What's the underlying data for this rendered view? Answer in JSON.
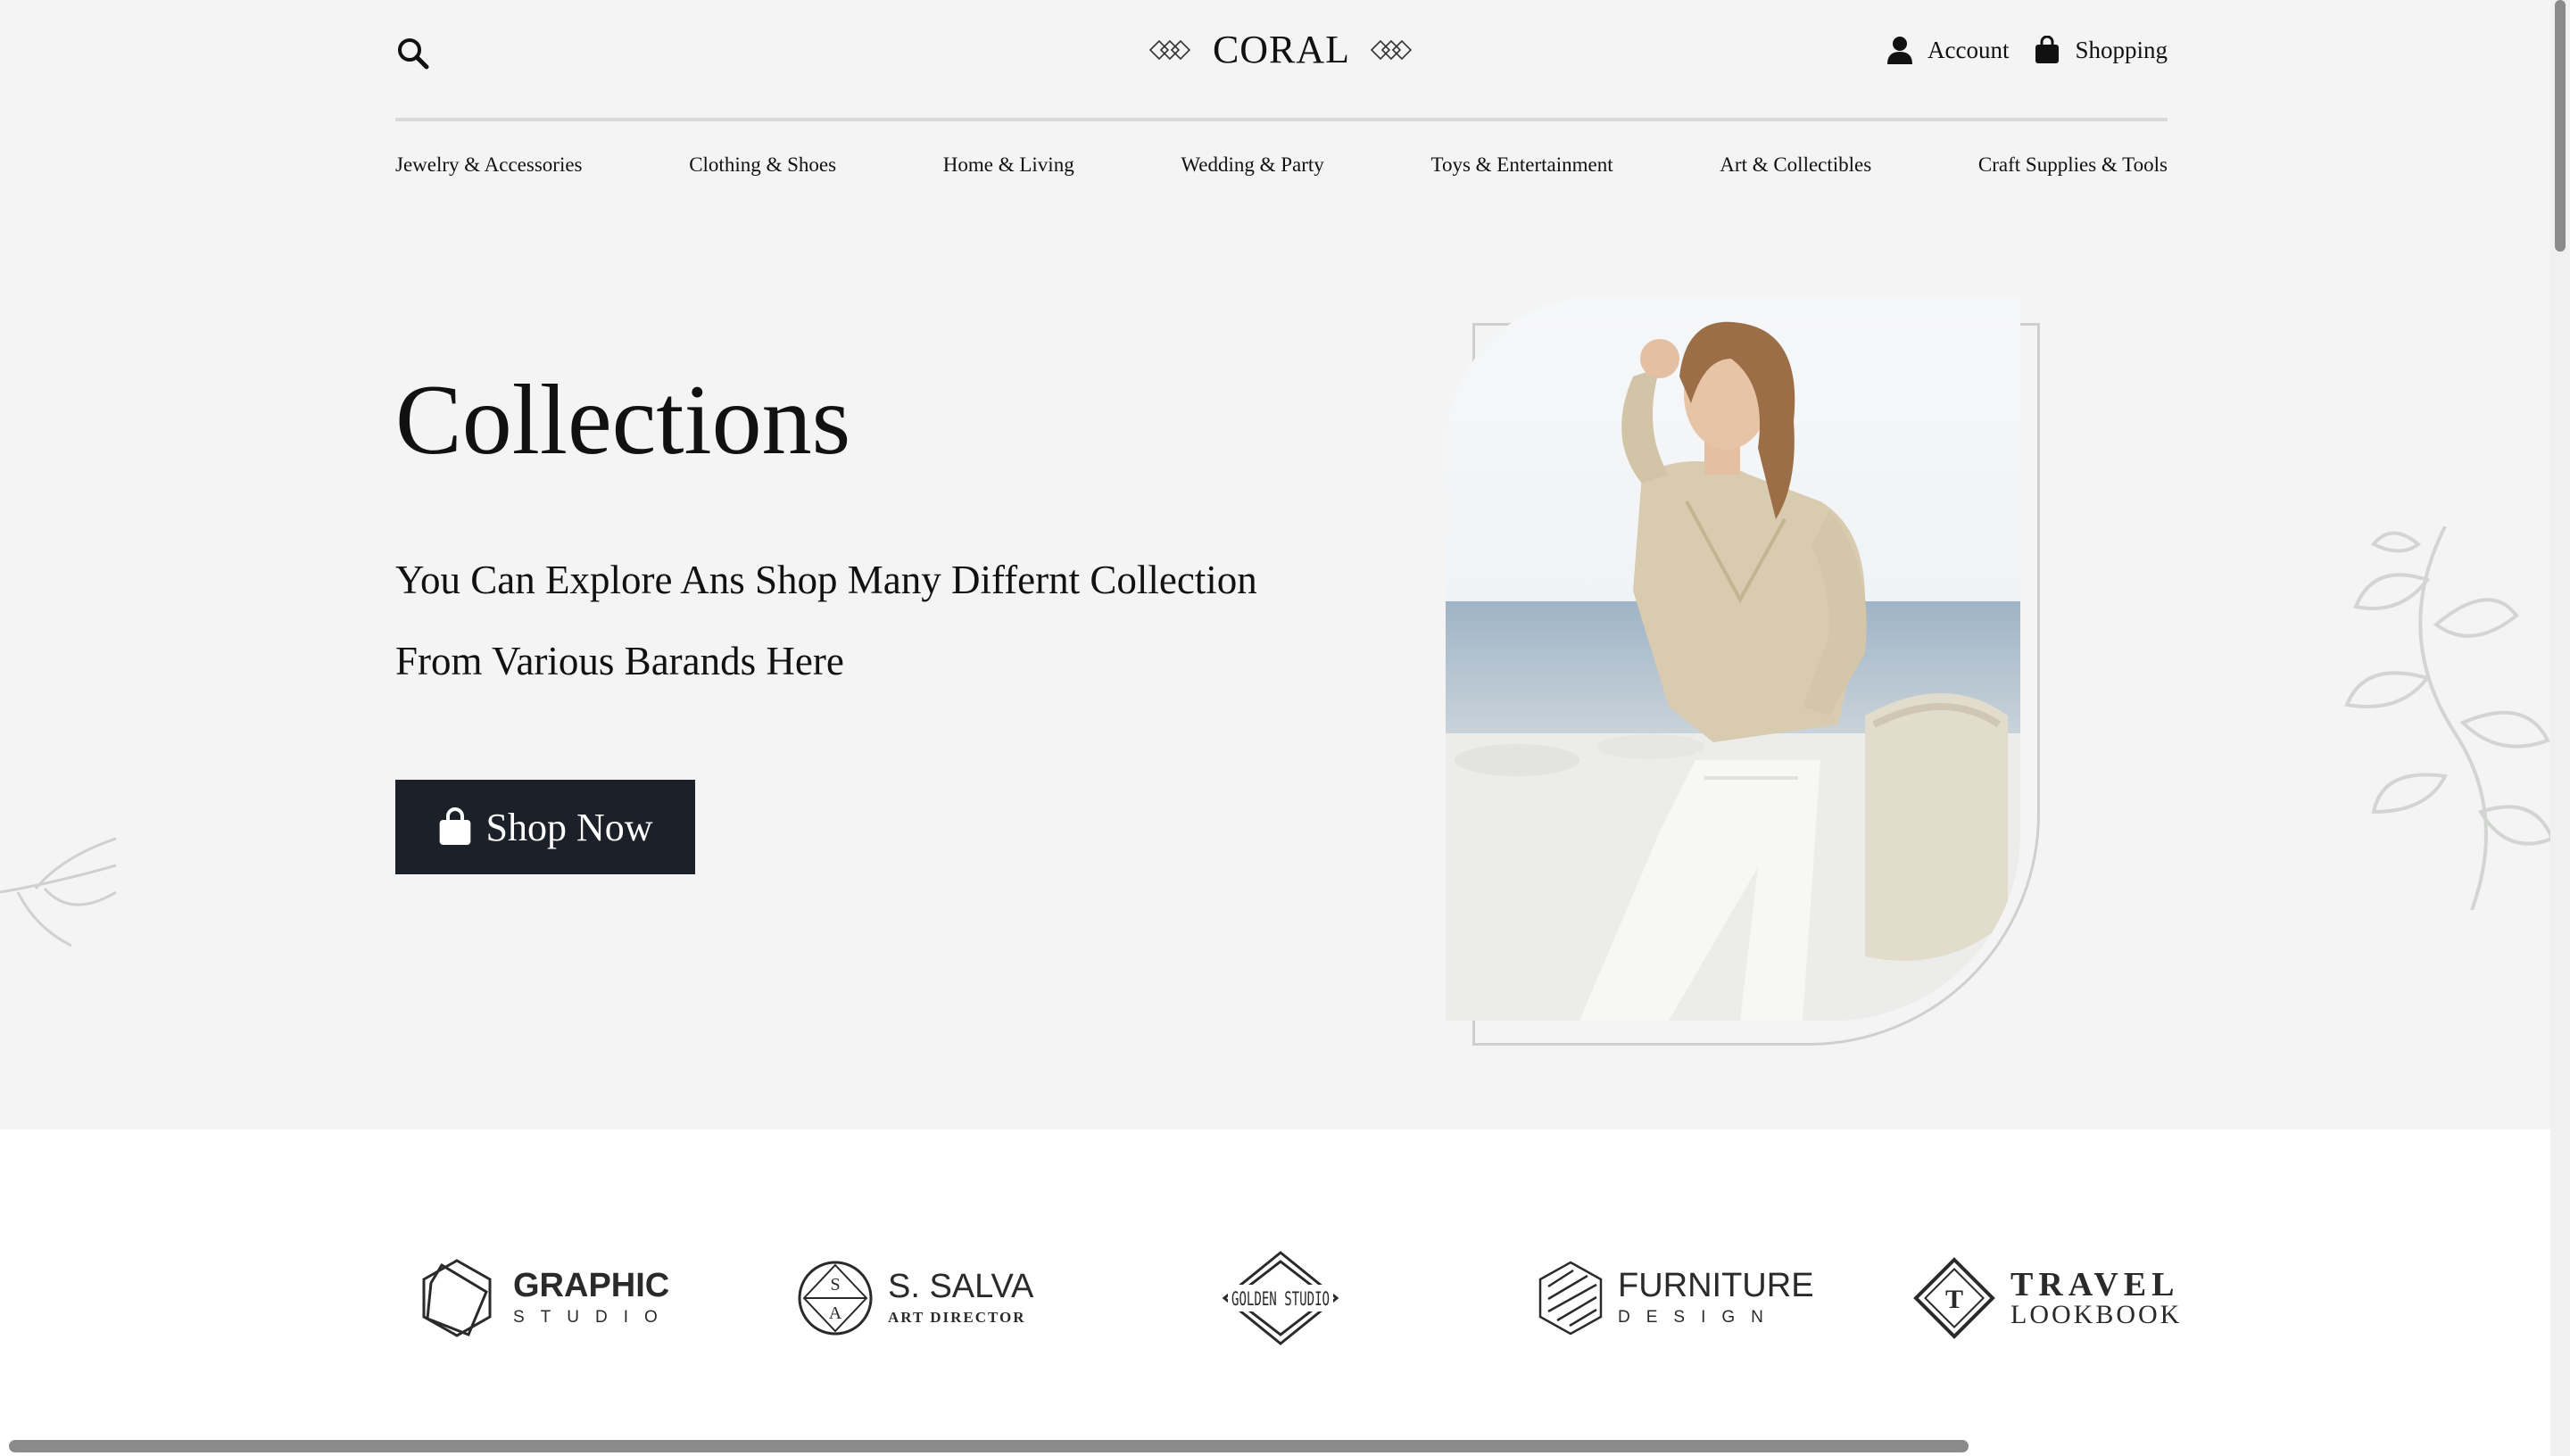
{
  "header": {
    "logo_text": "CORAL",
    "account_label": "Account",
    "shopping_label": "Shopping"
  },
  "nav": {
    "items": [
      "Jewelry & Accessories",
      "Clothing & Shoes",
      "Home & Living",
      "Wedding & Party",
      "Toys & Entertainment",
      "Art & Collectibles",
      "Craft Supplies & Tools"
    ]
  },
  "hero": {
    "title": "Collections",
    "subtitle": "You Can Explore Ans Shop Many Differnt Collection From Various Barands Here",
    "button_label": "Shop Now"
  },
  "brands": [
    {
      "main": "GRAPHIC",
      "sub": "STUDIO"
    },
    {
      "main": "S. SALVA",
      "sub": "ART DIRECTOR",
      "mark_top": "S",
      "mark_bottom": "A"
    },
    {
      "main": "GOLDEN STUDIO"
    },
    {
      "main": "FURNITURE",
      "sub": "DESIGN"
    },
    {
      "main": "TRAVEL",
      "sub": "LOOKBOOK",
      "mark": "T"
    }
  ],
  "icons": [
    "search-icon",
    "user-icon",
    "shopping-bag-icon",
    "leaf-decoration-icon"
  ],
  "colors": {
    "hero_background": "#f3f4f3",
    "button_background": "#1c2029",
    "button_text": "#ffffff"
  }
}
